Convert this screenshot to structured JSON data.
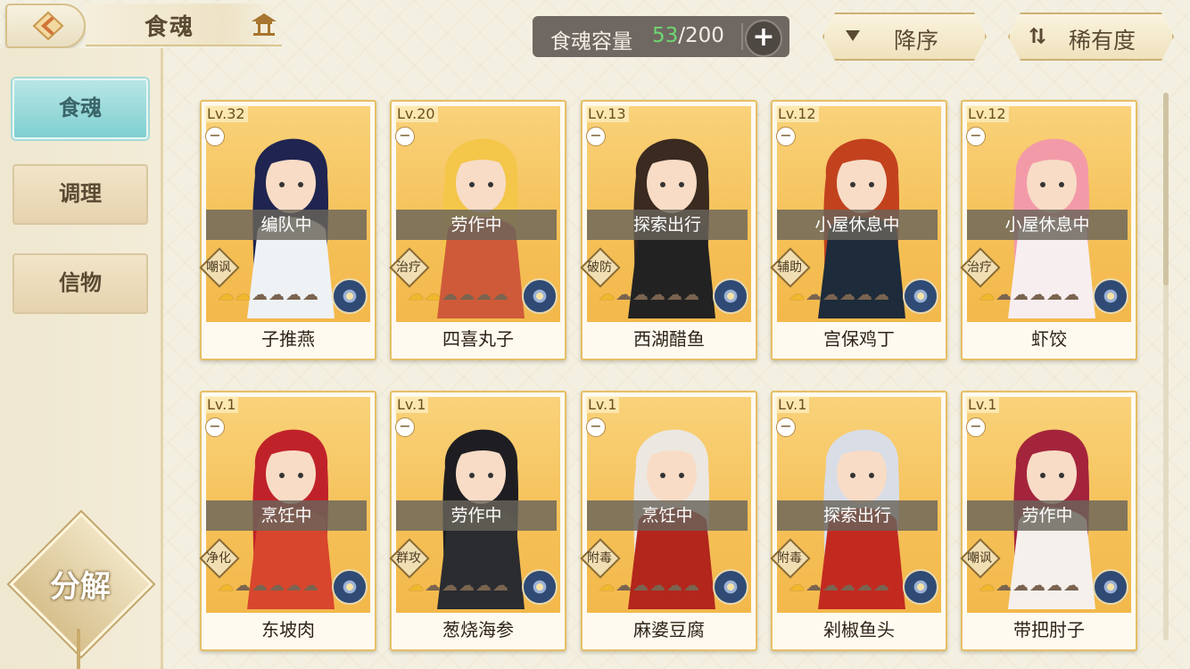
{
  "header": {
    "title": "食魂",
    "capacity_label": "食魂容量",
    "capacity_current": "53",
    "capacity_max": "/200",
    "add_label": "+",
    "sort_desc_label": "降序",
    "sort_rarity_label": "稀有度"
  },
  "sidebar": {
    "items": [
      {
        "label": "食魂",
        "active": true
      },
      {
        "label": "调理",
        "active": false
      },
      {
        "label": "信物",
        "active": false
      }
    ],
    "decompose_label": "分解"
  },
  "cards": [
    {
      "level": "Lv.32",
      "status": "编队中",
      "role": "嘲讽",
      "stars_on": 2,
      "stars_total": 6,
      "name": "子推燕",
      "hair": "#1f2550",
      "cloth": "#eef2f5"
    },
    {
      "level": "Lv.20",
      "status": "劳作中",
      "role": "治疗",
      "stars_on": 2,
      "stars_total": 6,
      "name": "四喜丸子",
      "hair": "#f4c64a",
      "cloth": "#cf5a3a"
    },
    {
      "level": "Lv.13",
      "status": "探索出行",
      "role": "破防",
      "stars_on": 1,
      "stars_total": 6,
      "name": "西湖醋鱼",
      "hair": "#3a2a20",
      "cloth": "#222222"
    },
    {
      "level": "Lv.12",
      "status": "小屋休息中",
      "role": "辅助",
      "stars_on": 1,
      "stars_total": 6,
      "name": "宫保鸡丁",
      "hair": "#c2421e",
      "cloth": "#1d2b3a"
    },
    {
      "level": "Lv.12",
      "status": "小屋休息中",
      "role": "治疗",
      "stars_on": 1,
      "stars_total": 6,
      "name": "虾饺",
      "hair": "#f39aa8",
      "cloth": "#f7eef0"
    },
    {
      "level": "Lv.1",
      "status": "烹饪中",
      "role": "净化",
      "stars_on": 1,
      "stars_total": 6,
      "name": "东坡肉",
      "hair": "#c0222a",
      "cloth": "#d8462d"
    },
    {
      "level": "Lv.1",
      "status": "劳作中",
      "role": "群攻",
      "stars_on": 1,
      "stars_total": 6,
      "name": "葱烧海参",
      "hair": "#1e1e22",
      "cloth": "#2a2c30"
    },
    {
      "level": "Lv.1",
      "status": "烹饪中",
      "role": "附毒",
      "stars_on": 1,
      "stars_total": 6,
      "name": "麻婆豆腐",
      "hair": "#ece7e0",
      "cloth": "#b2261c"
    },
    {
      "level": "Lv.1",
      "status": "探索出行",
      "role": "附毒",
      "stars_on": 1,
      "stars_total": 6,
      "name": "剁椒鱼头",
      "hair": "#d9dde6",
      "cloth": "#c22a20"
    },
    {
      "level": "Lv.1",
      "status": "劳作中",
      "role": "嘲讽",
      "stars_on": 1,
      "stars_total": 6,
      "name": "带把肘子",
      "hair": "#a4243c",
      "cloth": "#f5f0ec"
    }
  ],
  "icons": {
    "back": "back-arrow-icon",
    "home": "pavilion-icon",
    "desc": "triangle-down-icon",
    "rarity": "sort-arrows-icon"
  },
  "colors": {
    "accent_teal": "#7fcfd0",
    "capacity_highlight": "#6dd870",
    "card_border": "#e6bf64"
  }
}
